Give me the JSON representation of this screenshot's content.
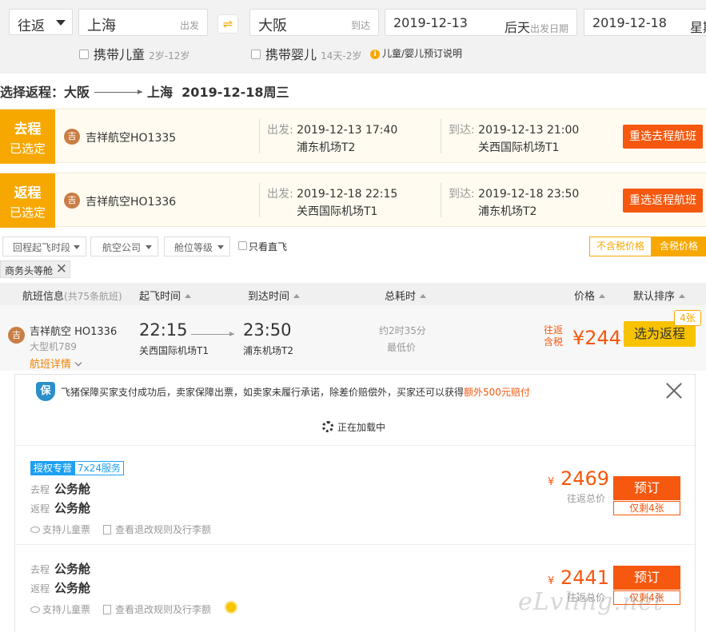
{
  "search": {
    "trip_type": "往返",
    "from_city": "上海",
    "from_hint": "出发",
    "to_city": "大阪",
    "to_hint": "到达",
    "depart_date": "2019-12-13",
    "depart_rel": "后天",
    "depart_hint": "出发日期",
    "return_date": "2019-12-18",
    "return_rel": "星期",
    "child_label": "携带儿童",
    "child_age": "2岁-12岁",
    "infant_label": "携带婴儿",
    "infant_age": "14天-2岁",
    "booking_info": "儿童/婴儿预订说明"
  },
  "route_header": {
    "prefix": "选择返程：大阪",
    "dest": "上海",
    "date": "2019-12-18周三"
  },
  "legs": [
    {
      "tag_title": "去程",
      "tag_status": "已选定",
      "airline": "吉祥航空HO1335",
      "dep_label": "出发:",
      "dep_time": "2019-12-13 17:40",
      "dep_airport": "浦东机场T2",
      "arr_label": "到达:",
      "arr_time": "2019-12-13 21:00",
      "arr_airport": "关西国际机场T1",
      "button": "重选去程航班"
    },
    {
      "tag_title": "返程",
      "tag_status": "已选定",
      "airline": "吉祥航空HO1336",
      "dep_label": "出发:",
      "dep_time": "2019-12-18 22:15",
      "dep_airport": "关西国际机场T1",
      "arr_label": "到达:",
      "arr_time": "2019-12-18 23:50",
      "arr_airport": "浦东机场T2",
      "button": "重选返程航班"
    }
  ],
  "filters": {
    "time": "回程起飞时段",
    "airline": "航空公司",
    "cabin": "舱位等级",
    "direct": "只看直飞",
    "no_tax": "不含税价格",
    "with_tax": "含税价格",
    "chip": "商务头等舱"
  },
  "table_head": {
    "info": "航班信息",
    "count": "(共75条航班)",
    "dep": "起飞时间",
    "arr": "到达时间",
    "duration": "总耗时",
    "price": "价格",
    "sort": "默认排序"
  },
  "flight": {
    "airline": "吉祥航空 HO1336",
    "aircraft": "大型机789",
    "details": "航班详情",
    "dep_time": "22:15",
    "dep_airport": "关西国际机场T1",
    "arr_time": "23:50",
    "arr_airport": "浦东机场T2",
    "duration": "约2时35分",
    "lowest": "最低价",
    "price_label_1": "往返",
    "price_label_2": "含税",
    "price": "¥2441",
    "select": "选为返程",
    "seats_badge": "4张"
  },
  "panel": {
    "notice": "飞猪保障买家支付成功后，卖家保障出票，如卖家未履行承诺，除差价赔偿外，买家还可以获得",
    "notice_highlight": "额外500元赔付",
    "loading": "正在加载中",
    "fares": [
      {
        "tag_a": "授权专营",
        "tag_b": "7x24服务",
        "out_label": "去程",
        "out_class": "公务舱",
        "ret_label": "返程",
        "ret_class": "公务舱",
        "feature_1": "支持儿童票",
        "feature_2": "查看退改规则及行李额",
        "currency": "¥",
        "price": "2469",
        "total_label": "往返总价",
        "book": "预订",
        "remaining": "仅剩4张"
      },
      {
        "out_label": "去程",
        "out_class": "公务舱",
        "ret_label": "返程",
        "ret_class": "公务舱",
        "feature_1": "支持儿童票",
        "feature_2": "查看退改规则及行李额",
        "currency": "¥",
        "price": "2441",
        "total_label": "往返总价",
        "book": "预订",
        "remaining": "仅剩4张"
      }
    ]
  },
  "watermark": "eLvling.net",
  "colors": {
    "accent": "#f7a800",
    "price": "#f5580e",
    "badge_blue": "#1ea0f0"
  }
}
